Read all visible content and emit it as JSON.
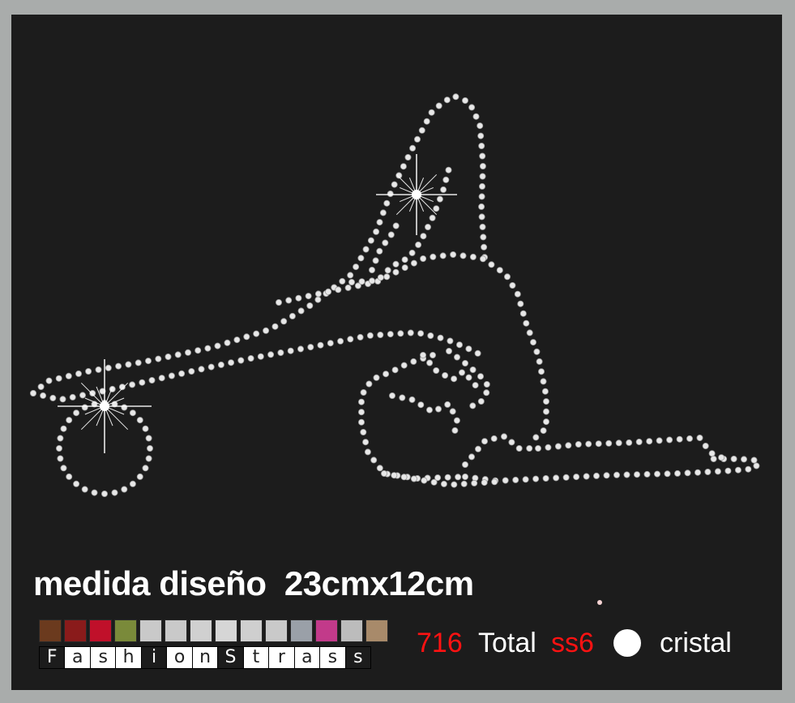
{
  "title": "medida diseño  23cmx12cm",
  "brand": {
    "letters": [
      "F",
      "a",
      "s",
      "h",
      "i",
      "o",
      "n",
      "S",
      "t",
      "r",
      "a",
      "s",
      "s"
    ],
    "swatch_colors": [
      "#6b3a1e",
      "#8a1b1b",
      "#c0102a",
      "#7a8a3a",
      "#c9c9c9",
      "#c9c9c9",
      "#d0d0d0",
      "#d6d6d6",
      "#cfcfcf",
      "#c9c9c9",
      "#9aa0a8",
      "#c23a8a",
      "#bcbcbc",
      "#a88a6a"
    ]
  },
  "legend": {
    "count": "716",
    "total_label": "Total",
    "stone_size": "ss6",
    "color_name": "cristal"
  },
  "colors": {
    "background": "#1c1c1c",
    "frame": "#a9acab",
    "rhinestone": "#e6e6e6",
    "accent_red": "#ff1212"
  }
}
